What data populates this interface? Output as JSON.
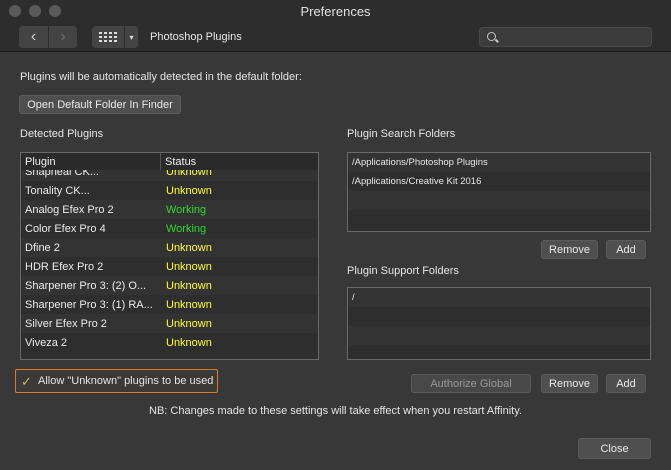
{
  "window": {
    "title": "Preferences"
  },
  "toolbar": {
    "back_glyph": "‹",
    "forward_glyph": "›",
    "dropdown_glyph": "▾",
    "section_label": "Photoshop Plugins",
    "search": {
      "value": "",
      "placeholder": ""
    }
  },
  "main": {
    "intro_text": "Plugins will be automatically detected in the default folder:",
    "open_folder_button": "Open Default Folder In Finder",
    "detected_label": "Detected Plugins",
    "table": {
      "headers": [
        "Plugin",
        "Status"
      ],
      "rows": [
        {
          "name": "Snapheal CK...",
          "status": "Unknown"
        },
        {
          "name": "Tonality CK...",
          "status": "Unknown"
        },
        {
          "name": "Analog Efex Pro 2",
          "status": "Working"
        },
        {
          "name": "Color Efex Pro 4",
          "status": "Working"
        },
        {
          "name": "Dfine 2",
          "status": "Unknown"
        },
        {
          "name": "HDR Efex Pro 2",
          "status": "Unknown"
        },
        {
          "name": "Sharpener Pro 3: (2) O...",
          "status": "Unknown"
        },
        {
          "name": "Sharpener Pro 3: (1) RA...",
          "status": "Unknown"
        },
        {
          "name": "Silver Efex Pro 2",
          "status": "Unknown"
        },
        {
          "name": "Viveza 2",
          "status": "Unknown"
        }
      ]
    },
    "search_folders": {
      "label": "Plugin Search Folders",
      "items": [
        "/Applications/Photoshop Plugins",
        "/Applications/Creative Kit 2016"
      ],
      "remove_button": "Remove",
      "add_button": "Add"
    },
    "support_folders": {
      "label": "Plugin Support Folders",
      "items": [
        "/"
      ],
      "authorize_button": "Authorize Global",
      "remove_button": "Remove",
      "add_button": "Add"
    },
    "allow_unknown": {
      "label": "Allow \"Unknown\" plugins to be used",
      "checked": true,
      "check_glyph": "✓"
    },
    "note": "NB: Changes made to these settings will take effect when you restart Affinity.",
    "close_button": "Close"
  },
  "colors": {
    "status_unknown": "#ffff2e",
    "status_working": "#2edb2e",
    "highlight_border": "#e07a2e"
  }
}
